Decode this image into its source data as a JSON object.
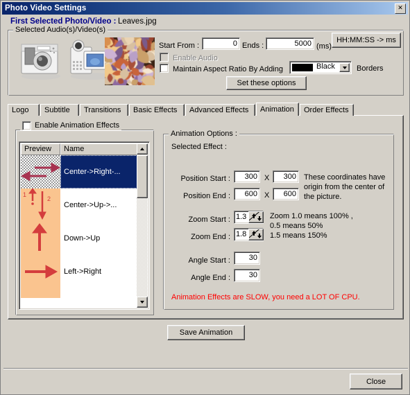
{
  "window": {
    "title": "Photo Video Settings",
    "close_glyph": "✕"
  },
  "header": {
    "label": "First Selected Photo/Video :",
    "filename": "Leaves.jpg"
  },
  "audio_group": {
    "title": "Selected Audio(s)/Video(s)",
    "start_from_label": "Start From :",
    "start_from_value": "0",
    "ends_label": "Ends :",
    "ends_value": "5000",
    "ms_label": "(ms)",
    "hhmmss_button": "HH:MM:SS -> ms",
    "enable_audio_label": "Enable Audio",
    "enable_audio_checked": false,
    "enable_audio_disabled": true,
    "maintain_aspect_label": "Maintain Aspect Ratio By Adding",
    "maintain_aspect_checked": false,
    "border_color_value": "Black",
    "border_color_hex": "#000000",
    "borders_label": "Borders",
    "set_options_button": "Set these options"
  },
  "tabs": [
    {
      "label": "Logo",
      "active": false
    },
    {
      "label": "Subtitle",
      "active": false
    },
    {
      "label": "Transitions",
      "active": false
    },
    {
      "label": "Basic Effects",
      "active": false
    },
    {
      "label": "Advanced Effects",
      "active": false
    },
    {
      "label": "Animation",
      "active": true
    },
    {
      "label": "Order Effects",
      "active": false
    }
  ],
  "animation_tab": {
    "enable_effects_label": "Enable Animation Effects",
    "enable_effects_checked": false,
    "list": {
      "columns": [
        "Preview",
        "Name"
      ],
      "rows": [
        {
          "name": "Center->Right-...",
          "selected": true,
          "preview": "center-right-left-arrows"
        },
        {
          "name": "Center->Up->...",
          "selected": false,
          "preview": "center-up-down-numbered-arrows"
        },
        {
          "name": "Down->Up",
          "selected": false,
          "preview": "up-arrow"
        },
        {
          "name": "Left->Right",
          "selected": false,
          "preview": "right-arrow"
        },
        {
          "name": "",
          "selected": false,
          "preview": "blank"
        }
      ]
    },
    "options": {
      "group_title": "Animation Options :",
      "selected_effect_label": "Selected Effect :",
      "position_start_label": "Position Start :",
      "position_start_x": "300",
      "position_start_y": "300",
      "position_end_label": "Position End :",
      "position_end_x": "600",
      "position_end_y": "600",
      "times_symbol": "X",
      "coords_note_line1": "These coordinates have",
      "coords_note_line2": "origin from the center of",
      "coords_note_line3": "the picture.",
      "zoom_start_label": "Zoom Start :",
      "zoom_start_value": "1.3",
      "zoom_end_label": "Zoom End :",
      "zoom_end_value": "1.8",
      "zoom_note_line1": "Zoom 1.0 means 100% ,",
      "zoom_note_line2": "0.5 means 50%",
      "zoom_note_line3": "1.5 means 150%",
      "angle_start_label": "Angle Start :",
      "angle_start_value": "30",
      "angle_end_label": "Angle End :",
      "angle_end_value": "30",
      "warning": "Animation Effects are SLOW, you need a LOT OF CPU.",
      "warning_color": "#ff0000"
    },
    "save_button": "Save Animation"
  },
  "footer": {
    "close_button": "Close"
  }
}
